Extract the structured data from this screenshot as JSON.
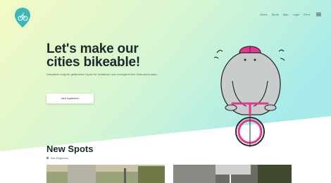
{
  "colors": {
    "hero_gradient_start": "#f3f9c6",
    "hero_gradient_end": "#a9ecea",
    "logo_teal": "#3db6b9",
    "accent_pink": "#e6348f",
    "mascot_gray": "#c9cccd"
  },
  "nav": {
    "items": [
      "About",
      "Spots",
      "Map",
      "Login"
    ],
    "language": "EN",
    "menu_icon": "hamburger-icon"
  },
  "hero": {
    "headline_line1": "Let's make our",
    "headline_line2": "cities bikeable!",
    "subtext": "Velopflicht zeigt dir gefährliche Spots für Velofahrer und ermöglicht eine Diskussion dazu.",
    "cta_label": "Jetzt registrieren"
  },
  "spots": {
    "title": "New Spots",
    "filter_label": "Alle Regionen"
  }
}
